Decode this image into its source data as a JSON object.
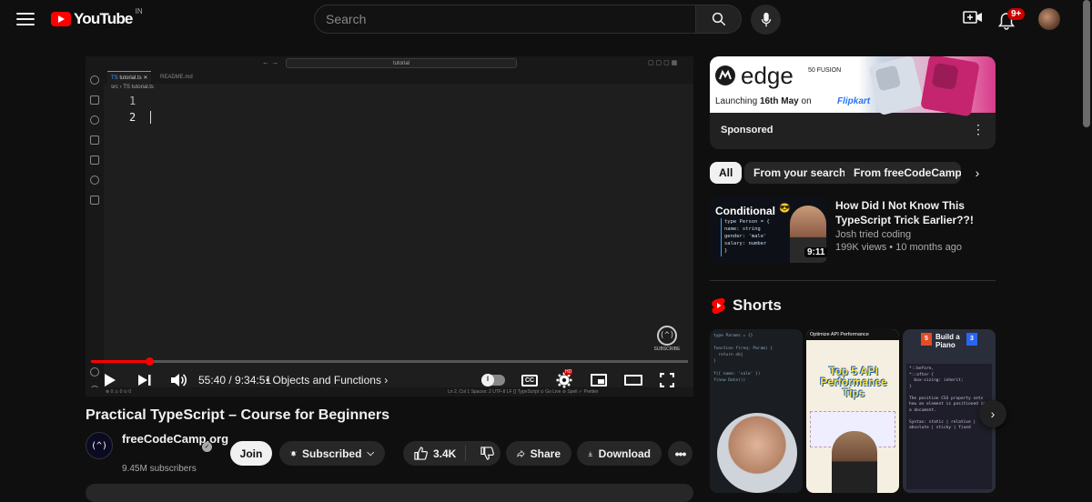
{
  "header": {
    "logo_text": "YouTube",
    "country_code": "IN",
    "search_placeholder": "Search",
    "notification_count": "9+"
  },
  "editor": {
    "command_center": "tutorial",
    "tabs": [
      "tutorial.ts",
      "README.md"
    ],
    "breadcrumb": "src  ›  TS tutorial.ts",
    "line_numbers": [
      "1",
      "2"
    ],
    "watermark": "SUBSCRIBE",
    "status_left": "⊗ 0 ⚠ 0   ⊙ 0",
    "status_right": "Ln 2, Col 1    Spaces: 2    UTF-8    LF    {} TypeScript    ⊙ Go Live    ⊘ Spell    ✓ Prettier"
  },
  "player": {
    "time": "55:40 / 9:34:51",
    "chapter": "Objects and Functions",
    "progress": 0.097
  },
  "video": {
    "title": "Practical TypeScript – Course for Beginners",
    "channel_name": "freeCodeCamp.org",
    "subscribers": "9.45M subscribers",
    "join_label": "Join",
    "subscribed_label": "Subscribed",
    "likes": "3.4K",
    "share_label": "Share",
    "download_label": "Download"
  },
  "ad": {
    "brand_title": "edge",
    "brand_sub": "50 FUSION",
    "launch_text_pre": "Launching",
    "launch_date": "16th May",
    "launch_on": "on",
    "store": "Flipkart",
    "sponsored_label": "Sponsored"
  },
  "chips": [
    "All",
    "From your search",
    "From freeCodeCamp.org"
  ],
  "recommended": {
    "thumb_title": "Conditional",
    "thumb_code": [
      "type Person = {",
      "  name: string",
      "  gender: 'male'",
      "  salary: number",
      "}"
    ],
    "title": "How Did I Not Know This TypeScript Trick Earlier??!",
    "channel": "Josh tried coding",
    "meta": "199K views • 10 months ago",
    "duration": "9:11"
  },
  "shorts": {
    "label": "Shorts",
    "items": [
      {
        "caption": ""
      },
      {
        "caption": "Top 5 API Performance Tips",
        "header": "Optimize API Performance"
      },
      {
        "caption": "Build a Piano"
      }
    ]
  },
  "colors": {
    "background": "#0f0f0f",
    "surface": "#272727",
    "accent_red": "#ff0000",
    "text_primary": "#f1f1f1",
    "text_secondary": "#aaaaaa"
  }
}
